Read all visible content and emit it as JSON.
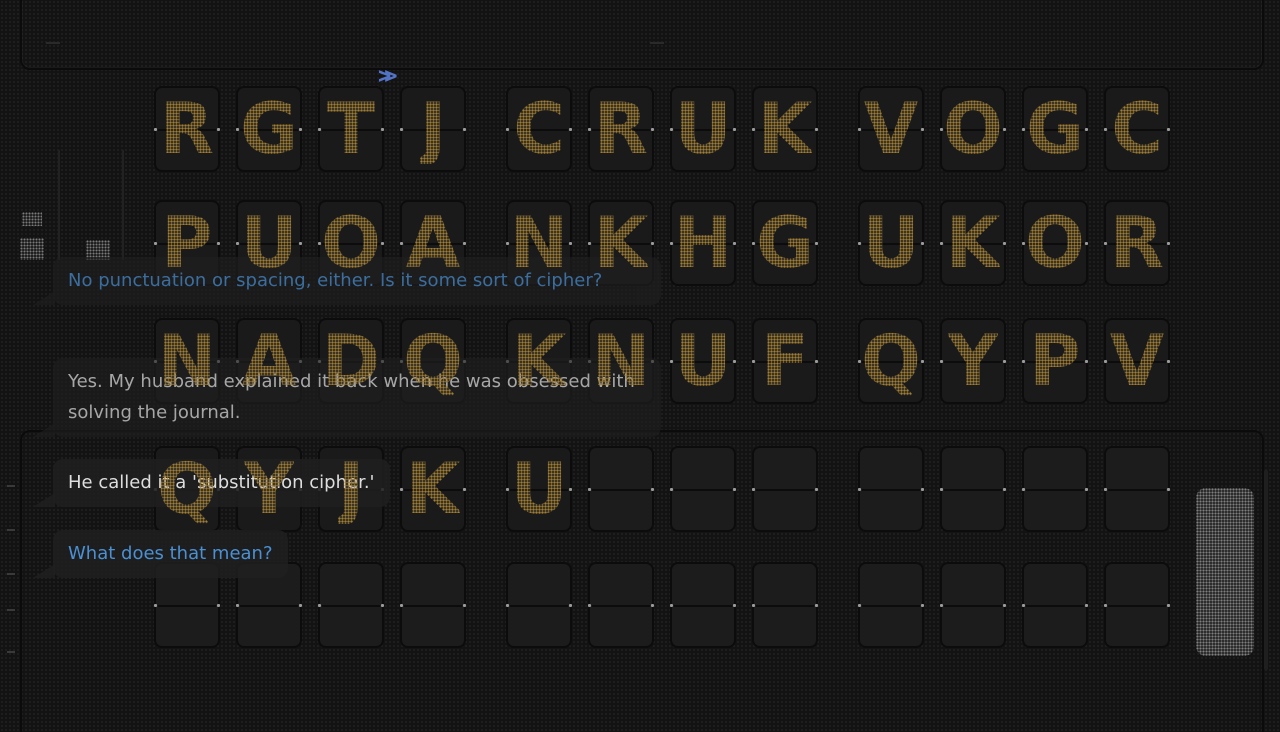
{
  "board": {
    "rows": [
      [
        "R",
        "G",
        "T",
        "J",
        "C",
        "R",
        "U",
        "K",
        "V",
        "O",
        "G",
        "C"
      ],
      [
        "P",
        "U",
        "O",
        "A",
        "N",
        "K",
        "H",
        "G",
        "U",
        "K",
        "O",
        "R"
      ],
      [
        "N",
        "A",
        "D",
        "Q",
        "K",
        "N",
        "U",
        "F",
        "Q",
        "Y",
        "P",
        "V"
      ],
      [
        "Q",
        "Y",
        "J",
        "K",
        "U",
        "",
        "",
        "",
        "",
        "",
        "",
        ""
      ],
      [
        "",
        "",
        "",
        "",
        "",
        "",
        "",
        "",
        "",
        "",
        "",
        ""
      ]
    ],
    "letter_color": "#a07e37"
  },
  "dialogue": [
    {
      "speaker": "player",
      "text": "No punctuation or spacing, either. Is it some sort of cipher?"
    },
    {
      "speaker": "npc",
      "text": "Yes. My husband explained it back when he was obsessed with solving the journal."
    },
    {
      "speaker": "npc",
      "text": "He called it a 'substitution cipher.'"
    },
    {
      "speaker": "player",
      "text": "What does that mean?"
    }
  ],
  "colors": {
    "player_text": "#4a90d4",
    "npc_text": "#dedede",
    "background": "#131313"
  },
  "indicator": {
    "icon": "double-chevron-right-icon",
    "color": "#5f86e6"
  }
}
